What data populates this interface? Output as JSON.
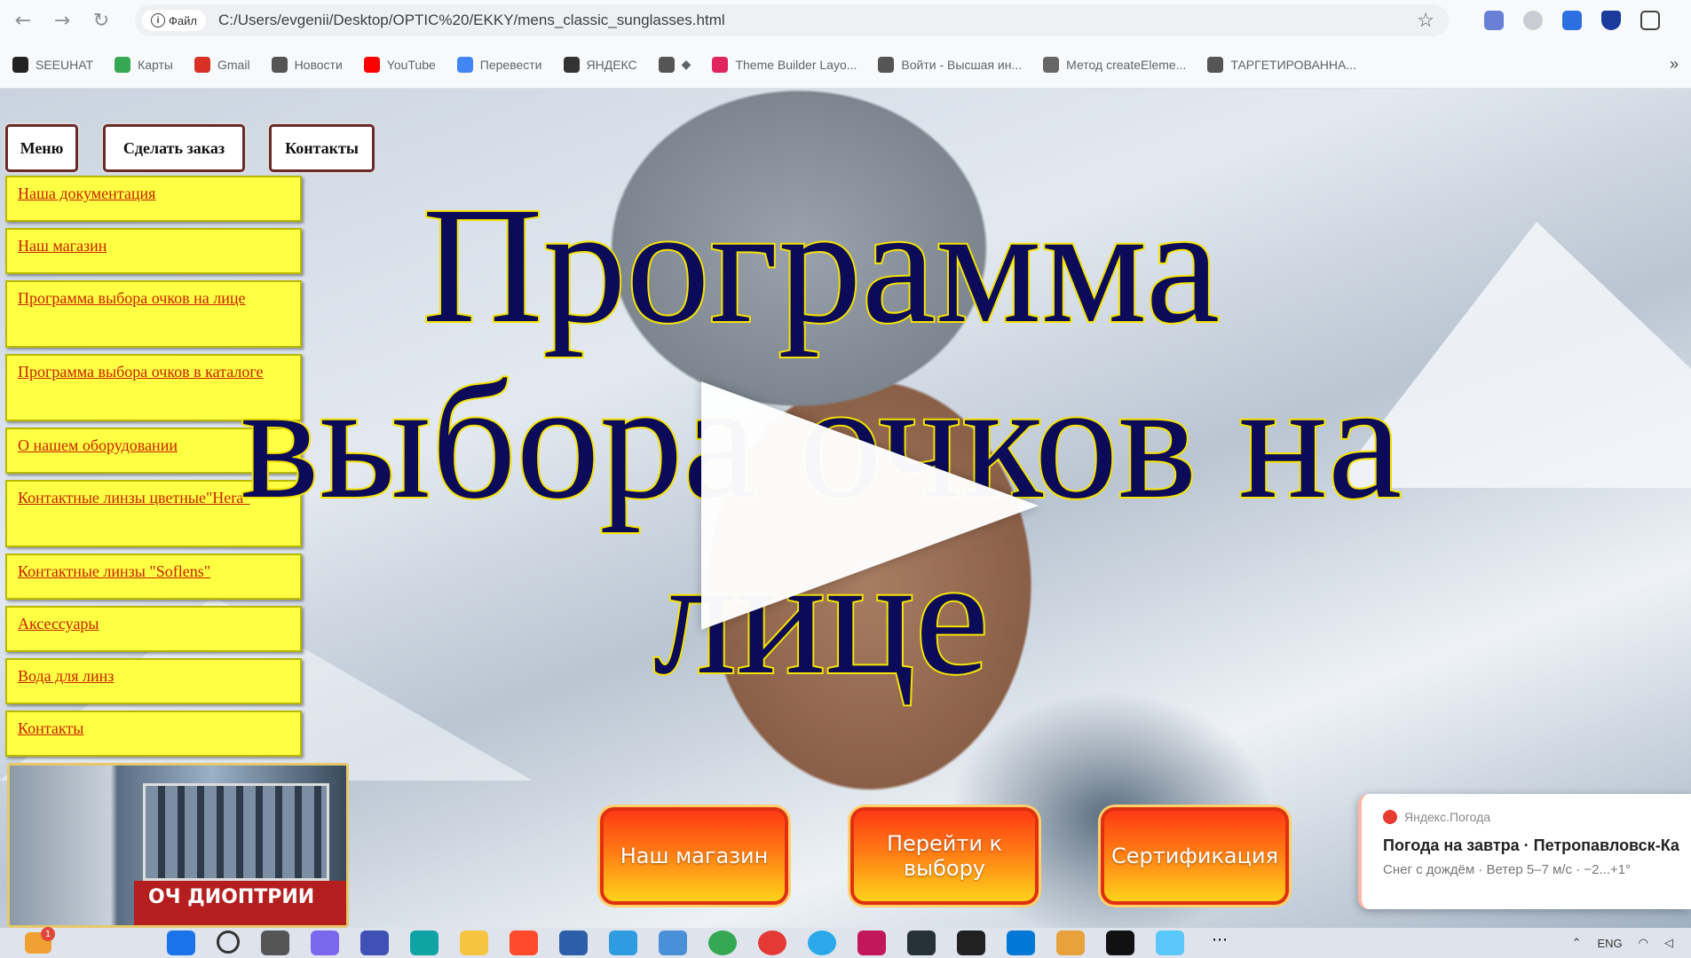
{
  "browser": {
    "file_chip": "Файл",
    "url": "C:/Users/evgenii/Desktop/OPTIC%20/EKKY/mens_classic_sunglasses.html",
    "bookmarks": [
      {
        "label": "SEEUHAT",
        "color": "#222222"
      },
      {
        "label": "Карты",
        "color": "#34a853"
      },
      {
        "label": "Gmail",
        "color": "#d93025"
      },
      {
        "label": "Новости",
        "color": "#555555"
      },
      {
        "label": "YouTube",
        "color": "#ff0000"
      },
      {
        "label": "Перевести",
        "color": "#4285f4"
      },
      {
        "label": "ЯНДЕКС",
        "color": "#333333"
      },
      {
        "label": "◆",
        "color": "#555555"
      },
      {
        "label": "Theme Builder Layo...",
        "color": "#e0245e"
      },
      {
        "label": "Войти - Высшая ин...",
        "color": "#555555"
      },
      {
        "label": "Метод createEleme...",
        "color": "#666666"
      },
      {
        "label": "ТАРГЕТИРОВАННА...",
        "color": "#555555"
      }
    ],
    "more": "»"
  },
  "page": {
    "top_buttons": {
      "menu": "Меню",
      "order": "Сделать заказ",
      "contacts": "Контакты"
    },
    "menu_items": [
      "Наша документация",
      "Наш магазин",
      "Программа выбора очков на лице",
      "Программа выбора очков в каталоге",
      "О нашем оборудовании",
      "Контактные линзы цветные\"Hera\"",
      "Контактные линзы \"Soflens\"",
      "Аксессуары",
      "Вода для линз",
      "Контакты"
    ],
    "headline": "Программа выбора очков на лице",
    "shop_sign": "ОЧ ДИОПТРИИ",
    "cta_buttons": [
      "Наш магазин",
      "Перейти к выбору",
      "Сертификация"
    ]
  },
  "notification": {
    "source": "Яндекс.Погода",
    "title": "Погода на завтра · Петропавловск-Ка",
    "body": "Снег с дождём · Ветер 5–7 м/с · −2...+1°"
  },
  "taskbar": {
    "badge": "1",
    "lang": "ENG",
    "more": "⋯"
  },
  "colors": {
    "menu_bg": "#ffff44",
    "menu_link": "#cc2200",
    "headline_fill": "#0b0b5a",
    "headline_stroke": "#f5e300",
    "cta_top": "#ff3a14",
    "cta_bottom": "#ffd21a"
  }
}
